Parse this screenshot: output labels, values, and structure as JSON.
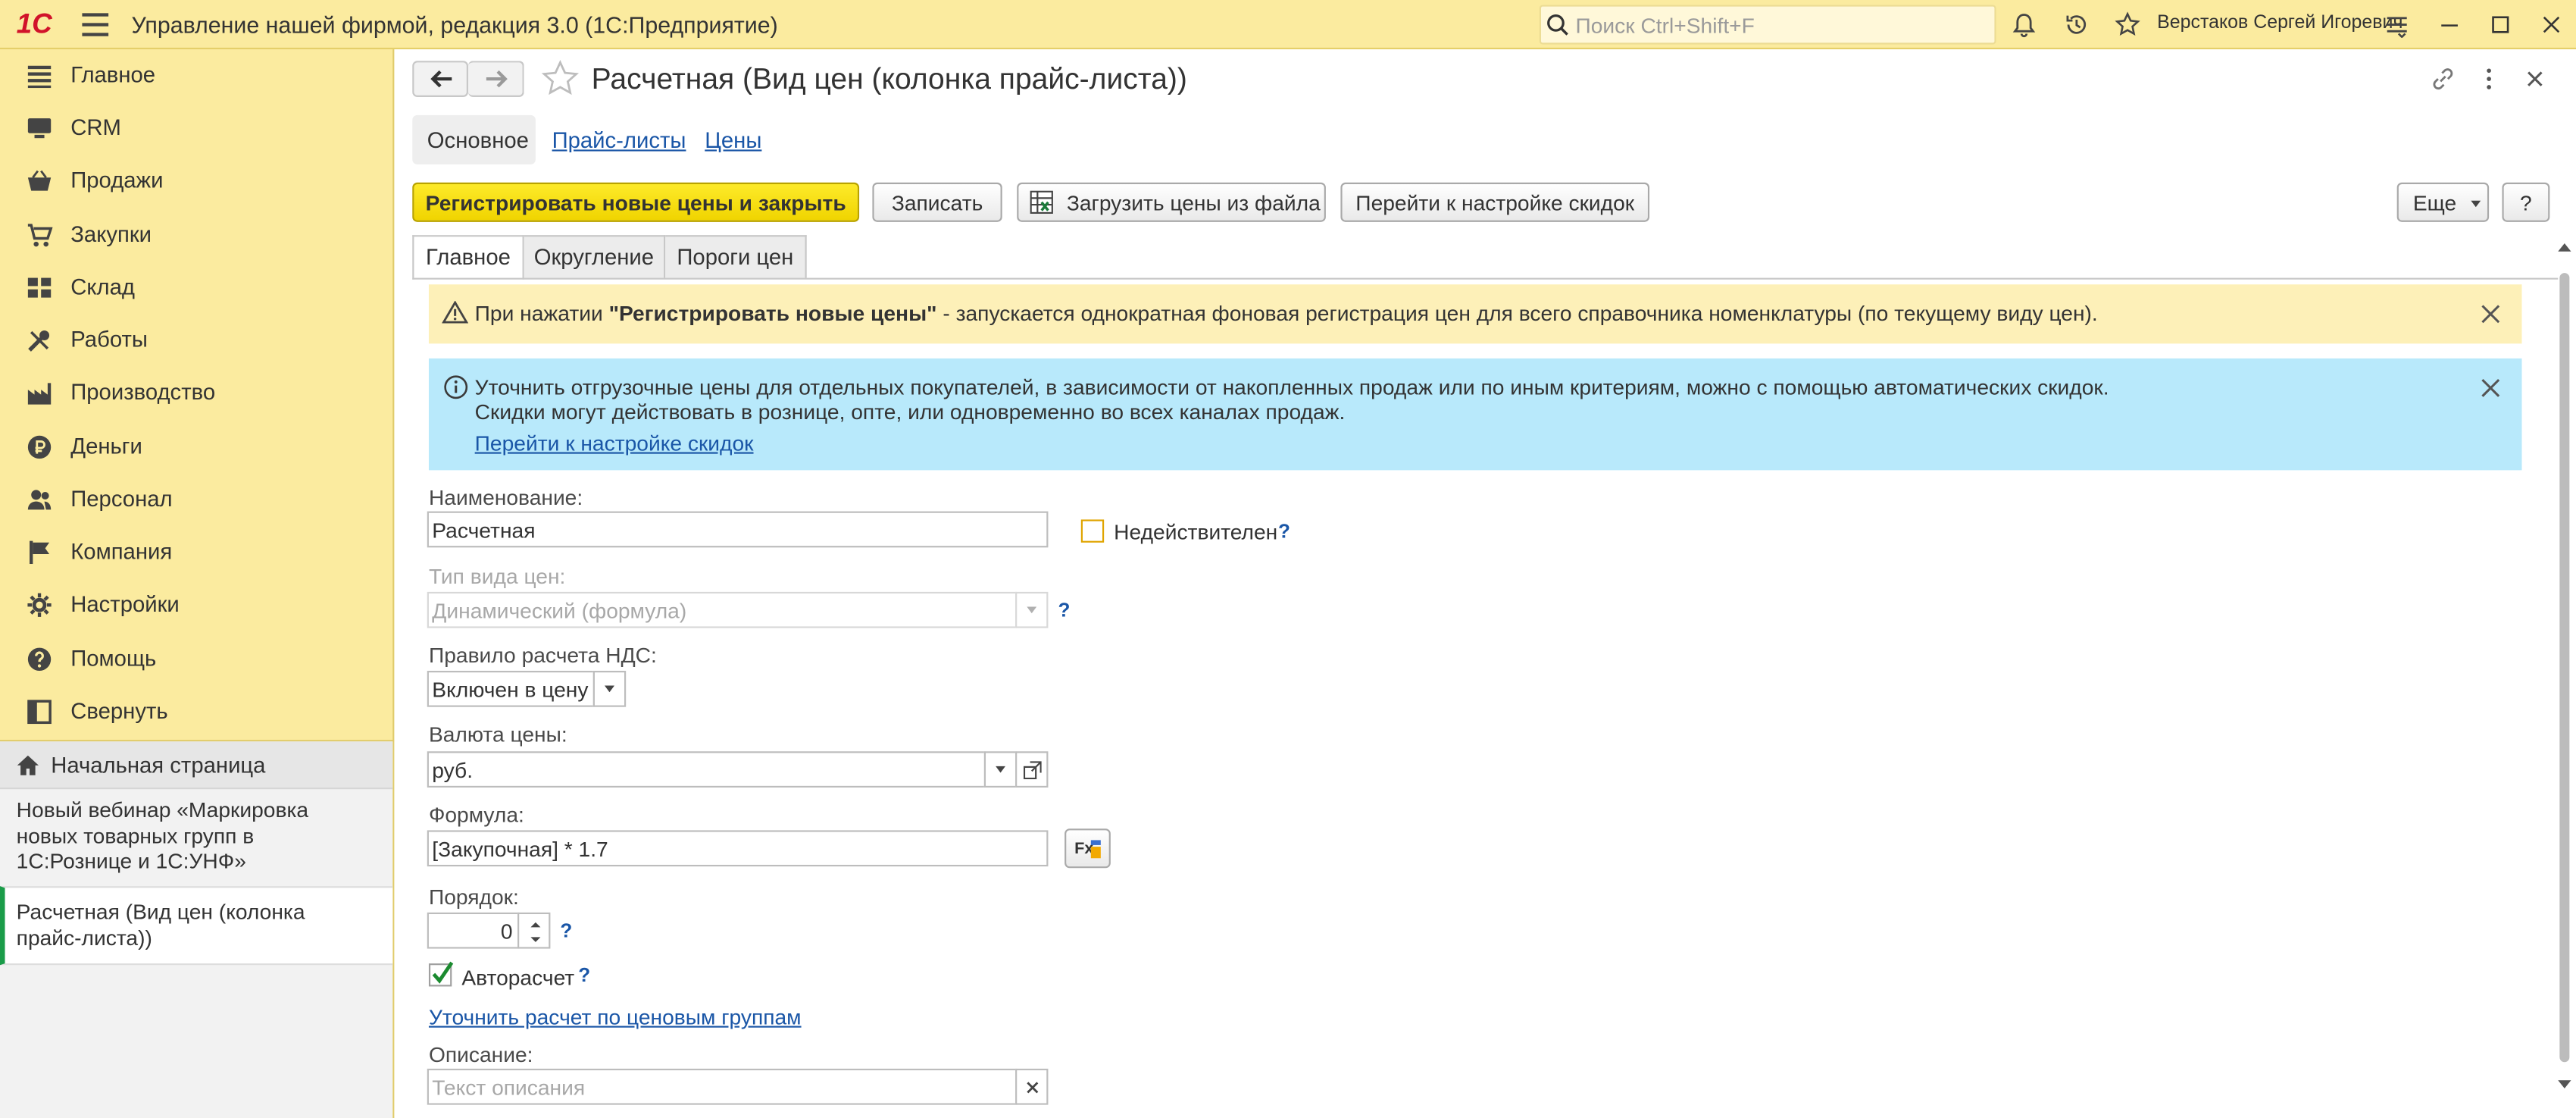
{
  "window": {
    "logo": "1С",
    "title": "Управление нашей фирмой, редакция 3.0  (1С:Предприятие)",
    "search_placeholder": "Поиск Ctrl+Shift+F",
    "user": "Верстаков Сергей Игоревич"
  },
  "sidebar": {
    "items": [
      {
        "label": "Главное",
        "icon": "list-icon"
      },
      {
        "label": "CRM",
        "icon": "monitor-icon"
      },
      {
        "label": "Продажи",
        "icon": "basket-icon"
      },
      {
        "label": "Закупки",
        "icon": "cart-icon"
      },
      {
        "label": "Склад",
        "icon": "grid-icon"
      },
      {
        "label": "Работы",
        "icon": "tools-icon"
      },
      {
        "label": "Производство",
        "icon": "factory-icon"
      },
      {
        "label": "Деньги",
        "icon": "ruble-icon"
      },
      {
        "label": "Персонал",
        "icon": "people-icon"
      },
      {
        "label": "Компания",
        "icon": "flag-icon"
      },
      {
        "label": "Настройки",
        "icon": "gear-icon"
      },
      {
        "label": "Помощь",
        "icon": "help-icon"
      },
      {
        "label": "Свернуть",
        "icon": "collapse-icon"
      }
    ],
    "open_windows": {
      "home": "Начальная страница",
      "webinar": "Новый вебинар «Маркировка новых товарных групп в 1С:Рознице и 1С:УНФ»",
      "current": "Расчетная (Вид цен (колонка прайс-листа))"
    }
  },
  "form": {
    "title": "Расчетная (Вид цен (колонка прайс-листа))",
    "section_tabs": [
      "Основное",
      "Прайс-листы",
      "Цены"
    ],
    "buttons": {
      "register": "Регистрировать новые цены и закрыть",
      "save": "Записать",
      "load": "Загрузить цены из файла",
      "discounts": "Перейти к настройке скидок",
      "more": "Еще",
      "help": "?"
    },
    "tabs": [
      "Главное",
      "Округление",
      "Пороги цен"
    ],
    "warning": {
      "prefix": "При нажатии ",
      "bold": "\"Регистрировать новые цены\"",
      "suffix": " - запускается однократная фоновая регистрация цен для всего справочника номенклатуры (по текущему виду цен)."
    },
    "info": {
      "line1": "Уточнить отгрузочные цены для отдельных покупателей, в зависимости от накопленных продаж или по иным критериям, можно с помощью автоматических скидок.",
      "line2": "Скидки могут действовать в рознице, опте, или одновременно во всех каналах продаж.",
      "link": "Перейти к настройке скидок"
    },
    "fields": {
      "name_label": "Наименование:",
      "name_value": "Расчетная",
      "inactive_label": "Недействителен",
      "inactive_checked": false,
      "price_type_label": "Тип вида цен:",
      "price_type_value": "Динамический (формула)",
      "vat_label": "Правило расчета НДС:",
      "vat_value": "Включен в цену",
      "currency_label": "Валюта цены:",
      "currency_value": "руб.",
      "formula_label": "Формула:",
      "formula_value": "[Закупочная] * 1.7",
      "order_label": "Порядок:",
      "order_value": "0",
      "autocalc_label": "Авторасчет",
      "autocalc_checked": true,
      "groups_link": "Уточнить расчет по ценовым группам",
      "description_label": "Описание:",
      "description_placeholder": "Текст описания",
      "help_mark": "?"
    }
  },
  "colors": {
    "panel": "#fbeb9f",
    "accent_button": "#f5dc0a",
    "warning_bg": "#fdf0b8",
    "info_bg": "#b8e9fb",
    "link": "#1a56a7",
    "active_marker": "#1a9c49"
  }
}
